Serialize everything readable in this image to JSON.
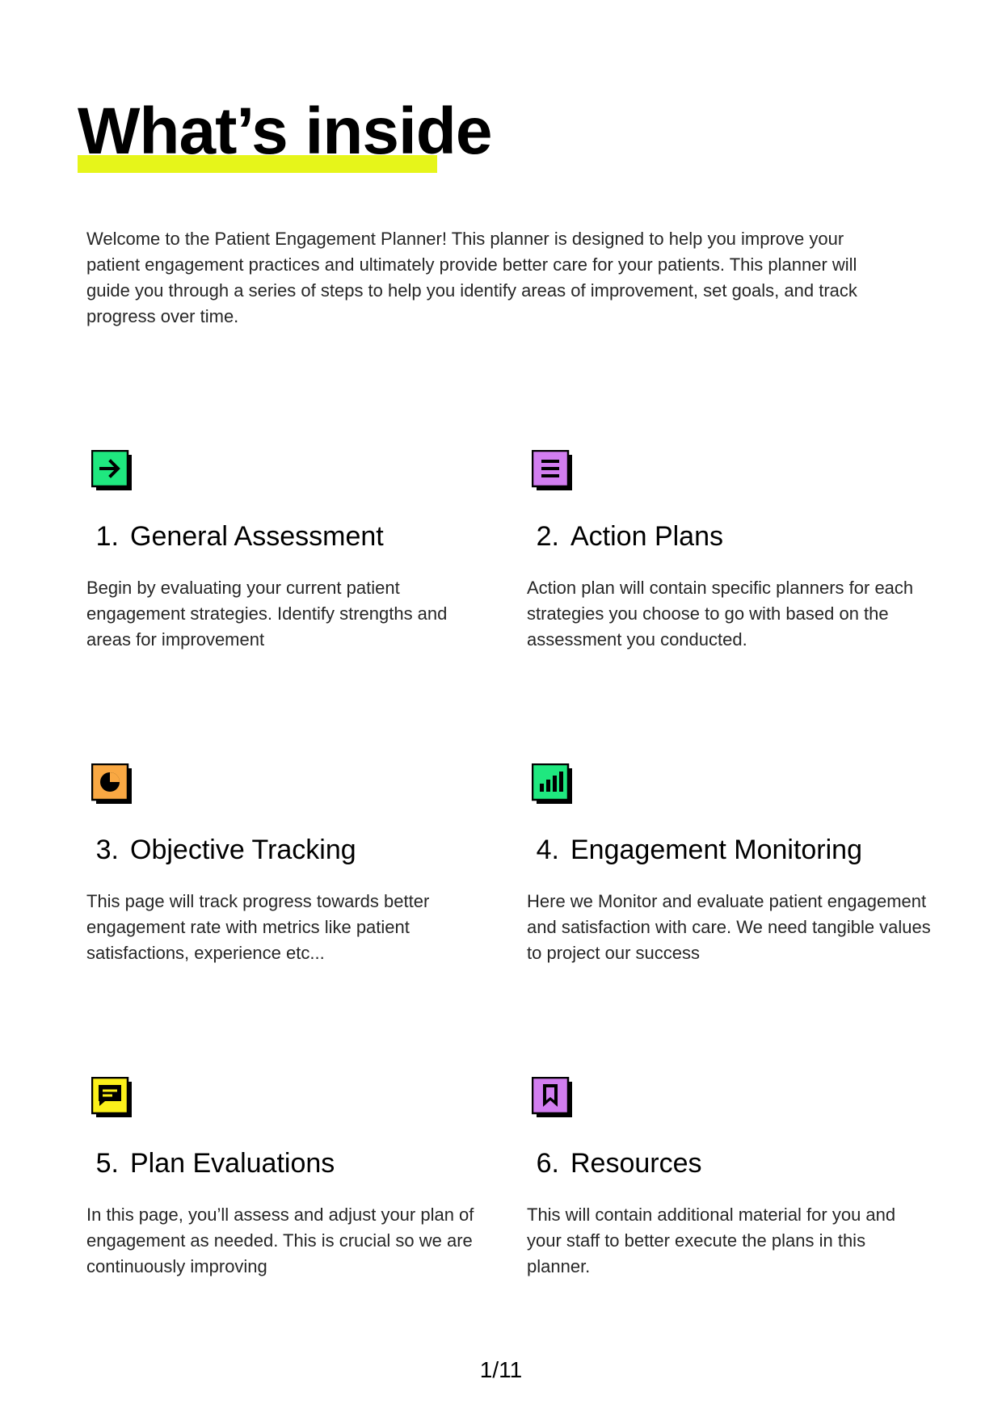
{
  "page": {
    "title": "What’s inside",
    "intro": "Welcome to the Patient Engagement Planner! This planner is designed to help you improve your patient engagement practices and ultimately provide better care for your patients. This planner will guide you through a series of steps to help you identify areas of improvement, set goals, and track progress over time.",
    "page_number": "1/11"
  },
  "colors": {
    "highlight": "#e6f51a",
    "green": "#1fe87f",
    "purple": "#d27ef0",
    "orange": "#f9a843",
    "yellow": "#fbf01a"
  },
  "sections": [
    {
      "number": "1.",
      "title": "General Assessment",
      "description": "Begin by evaluating your current patient engagement strategies. Identify strengths and areas for improvement",
      "icon": "arrow-right-icon",
      "icon_color": "#1fe87f"
    },
    {
      "number": "2.",
      "title": "Action Plans",
      "description": "Action plan will contain specific planners for each strategies you choose to go with based on the assessment you conducted.",
      "icon": "list-icon",
      "icon_color": "#d27ef0"
    },
    {
      "number": "3.",
      "title": "Objective Tracking",
      "description": "This page will track progress towards better engagement rate with metrics like patient satisfactions, experience etc...",
      "icon": "pie-chart-icon",
      "icon_color": "#f9a843"
    },
    {
      "number": "4.",
      "title": "Engagement Monitoring",
      "description": "Here we Monitor and evaluate patient engagement and satisfaction with care. We need tangible values to project our success",
      "icon": "bar-chart-icon",
      "icon_color": "#1fe87f"
    },
    {
      "number": "5.",
      "title": "Plan Evaluations",
      "description": "In this page, you’ll assess and adjust your plan of engagement as needed. This is crucial so we are continuously improving",
      "icon": "chat-bubble-icon",
      "icon_color": "#fbf01a"
    },
    {
      "number": "6.",
      "title": "Resources",
      "description": "This will contain additional material for you and your staff to better execute the plans in this planner.",
      "icon": "bookmark-icon",
      "icon_color": "#d27ef0"
    }
  ]
}
